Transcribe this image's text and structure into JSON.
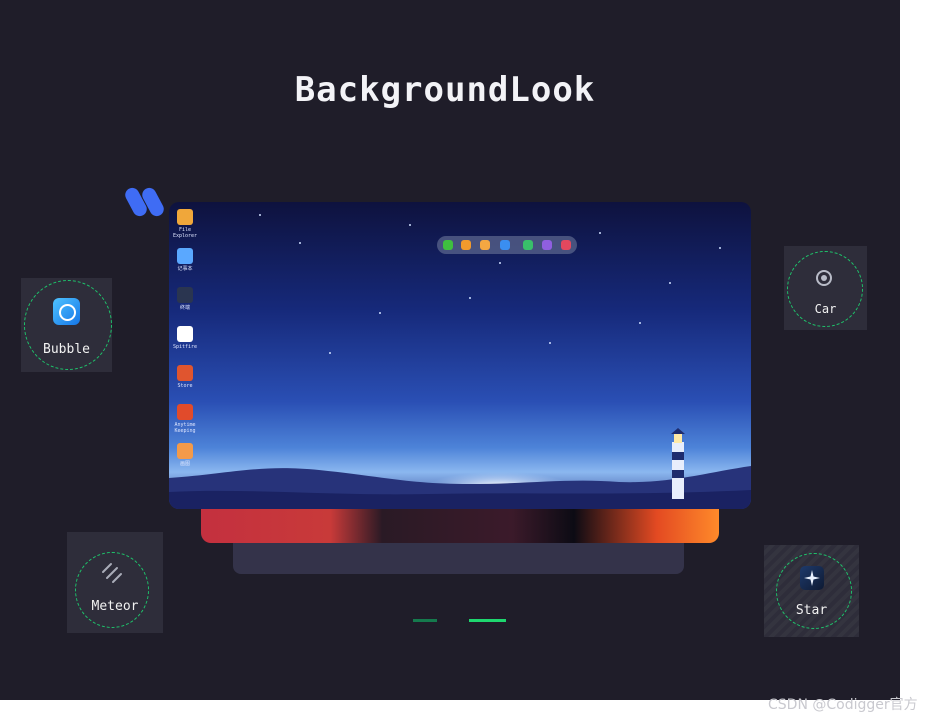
{
  "title": "BackgroundLook",
  "cards": [
    {
      "label": "Bubble",
      "icon": "bubble-icon"
    },
    {
      "label": "Car",
      "icon": "car-icon"
    },
    {
      "label": "Meteor",
      "icon": "meteor-icon"
    },
    {
      "label": "Star",
      "icon": "star-icon"
    }
  ],
  "desktop": {
    "icons": [
      {
        "label": "File Explorer",
        "color": "#f0a73a"
      },
      {
        "label": "记事本",
        "color": "#5aa8ff"
      },
      {
        "label": "终端",
        "color": "#2a3550"
      },
      {
        "label": "Spitfire",
        "color": "#ffffff"
      },
      {
        "label": "Store",
        "color": "#e0552f"
      },
      {
        "label": "Anytime Keeping",
        "color": "#e14b2b"
      },
      {
        "label": "画图",
        "color": "#f39a4a"
      }
    ],
    "dock_colors": [
      "#3fbf3f",
      "#f09a2d",
      "#f4a742",
      "#3a8ef0",
      "#39c06a",
      "#8f5fe0",
      "#e3485e"
    ]
  },
  "carousel": {
    "active_index": 1,
    "count": 2
  },
  "colors": {
    "accent_green": "#1ed76f",
    "background": "#1f1d29",
    "card": "#2e2d3a"
  },
  "watermark": "CSDN @Codigger官方"
}
